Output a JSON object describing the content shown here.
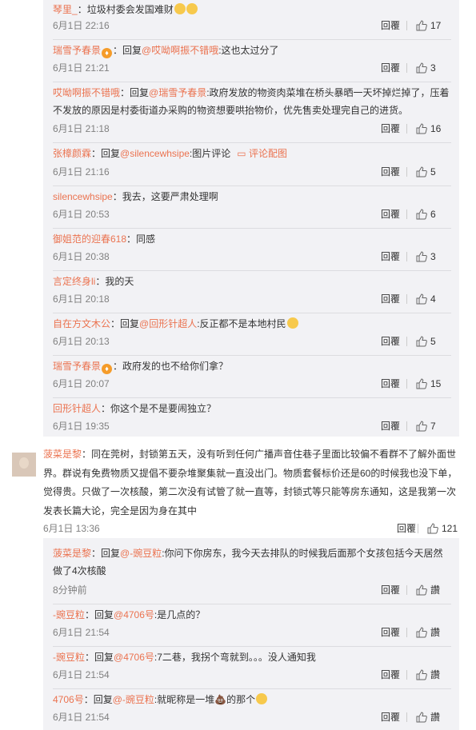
{
  "top_replies": [
    {
      "user": "琴里_",
      "sep": "：",
      "text": "垃圾村委会发国难财",
      "emojis": 2,
      "time": "6月1日 22:16",
      "reply_label": "回覆",
      "likes": "17"
    },
    {
      "user": "瑞雪予春景",
      "badge": true,
      "sep": "：回复",
      "reply_to": "@哎呦啊振不错哦",
      "text": ":这也太过分了",
      "time": "6月1日 21:21",
      "reply_label": "回覆",
      "likes": "3"
    },
    {
      "user": "哎呦啊振不错哦",
      "sep": "：回复",
      "reply_to": "@瑞雪予春景",
      "text": ":政府发放的物资肉菜堆在桥头暴晒一天坏掉烂掉了，压着不发放的原因是村委街道办采购的物资想要哄抬物价，优先售卖处理完自己的进货。",
      "time": "6月1日 21:18",
      "reply_label": "回覆",
      "likes": "16"
    },
    {
      "user": "张樟颜霖",
      "sep": "：回复",
      "reply_to": "@silencewhsipe",
      "text": ":图片评论",
      "pic": "评论配图",
      "time": "6月1日 21:16",
      "reply_label": "回覆",
      "likes": "5"
    },
    {
      "user": "silencewhsipe",
      "sep": "：",
      "text": "我去，这要严肃处理啊",
      "time": "6月1日 20:53",
      "reply_label": "回覆",
      "likes": "6"
    },
    {
      "user": "御姐范的迎春618",
      "sep": "：",
      "text": "同感",
      "time": "6月1日 20:38",
      "reply_label": "回覆",
      "likes": "3"
    },
    {
      "user": "言定终身li",
      "sep": "：",
      "text": "我的天",
      "time": "6月1日 20:18",
      "reply_label": "回覆",
      "likes": "4"
    },
    {
      "user": "自在方文木公",
      "sep": "：回复",
      "reply_to": "@回形针超人",
      "text": ":反正都不是本地村民",
      "emojis": 1,
      "time": "6月1日 20:13",
      "reply_label": "回覆",
      "likes": "5"
    },
    {
      "user": "瑞雪予春景",
      "badge": true,
      "sep": "：",
      "text": "政府发的也不给你们拿？",
      "time": "6月1日 20:07",
      "reply_label": "回覆",
      "likes": "15"
    },
    {
      "user": "回形针超人",
      "sep": "：",
      "text": "你这个是不是要闹独立？",
      "time": "6月1日 19:35",
      "reply_label": "回覆",
      "likes": "7"
    }
  ],
  "main_comment": {
    "user": "菠菜是黎",
    "sep": "：",
    "text": "同在莞树，封锁第五天，没有听到任何广播声音住巷子里面比较偏不看群不了解外面世界。群说有免费物质又提倡不要杂堆聚集就一直没出门。物质套餐标价还是60的时候我也没下单，觉得贵。只做了一次核酸，第二次没有试管了就一直等，封锁式等只能等房东通知，这是我第一次发表长篇大论，完全是因为身在其中",
    "time": "6月1日 13:36",
    "reply_label": "回覆",
    "likes": "121"
  },
  "sub_replies": [
    {
      "user": "菠菜是黎",
      "sep": "：回复",
      "reply_to": "@-豌豆粒",
      "text": ":你问下你房东，我今天去排队的时候我后面那个女孩包括今天居然做了4次核酸",
      "time": "8分钟前",
      "reply_label": "回覆",
      "likes": "讚"
    },
    {
      "user": "-豌豆粒",
      "sep": "：回复",
      "reply_to": "@4706号",
      "text": ":是几点的？",
      "time": "6月1日 21:54",
      "reply_label": "回覆",
      "likes": "讚"
    },
    {
      "user": "-豌豆粒",
      "sep": "：回复",
      "reply_to": "@4706号",
      "text": ":7二巷，我拐个弯就到。。。没人通知我",
      "time": "6月1日 21:54",
      "reply_label": "回覆",
      "likes": "讚"
    },
    {
      "user": "4706号",
      "sep": "：回复",
      "reply_to": "@-豌豆粒",
      "text": ":就昵称是一堆💩的那个",
      "emojis": 1,
      "time": "6月1日 21:54",
      "reply_label": "回覆",
      "likes": "讚"
    }
  ]
}
